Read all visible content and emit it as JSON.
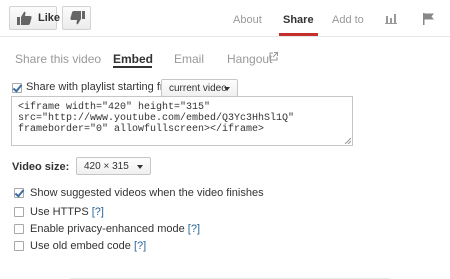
{
  "toolbar": {
    "like_label": "Like"
  },
  "tabs": [
    {
      "label": "About"
    },
    {
      "label": "Share"
    },
    {
      "label": "Add to"
    }
  ],
  "share_nav": [
    {
      "label": "Share this video"
    },
    {
      "label": "Embed"
    },
    {
      "label": "Email"
    },
    {
      "label": "Hangout"
    }
  ],
  "playlist": {
    "label": "Share with playlist starting from",
    "checked": true,
    "selected": "current video"
  },
  "embed_code": "<iframe width=\"420\" height=\"315\"\nsrc=\"http://www.youtube.com/embed/Q3Yc3HhSl1Q\"\nframeborder=\"0\" allowfullscreen></iframe>",
  "video_size": {
    "label": "Video size:",
    "selected": "420 × 315"
  },
  "options": [
    {
      "label": "Show suggested videos when the video finishes",
      "checked": true,
      "help": ""
    },
    {
      "label": "Use HTTPS",
      "checked": false,
      "help": "[?]"
    },
    {
      "label": "Enable privacy-enhanced mode",
      "checked": false,
      "help": "[?]"
    },
    {
      "label": "Use old embed code",
      "checked": false,
      "help": "[?]"
    }
  ],
  "colors": {
    "accent": "#c4302b",
    "link": "#2a6496"
  }
}
